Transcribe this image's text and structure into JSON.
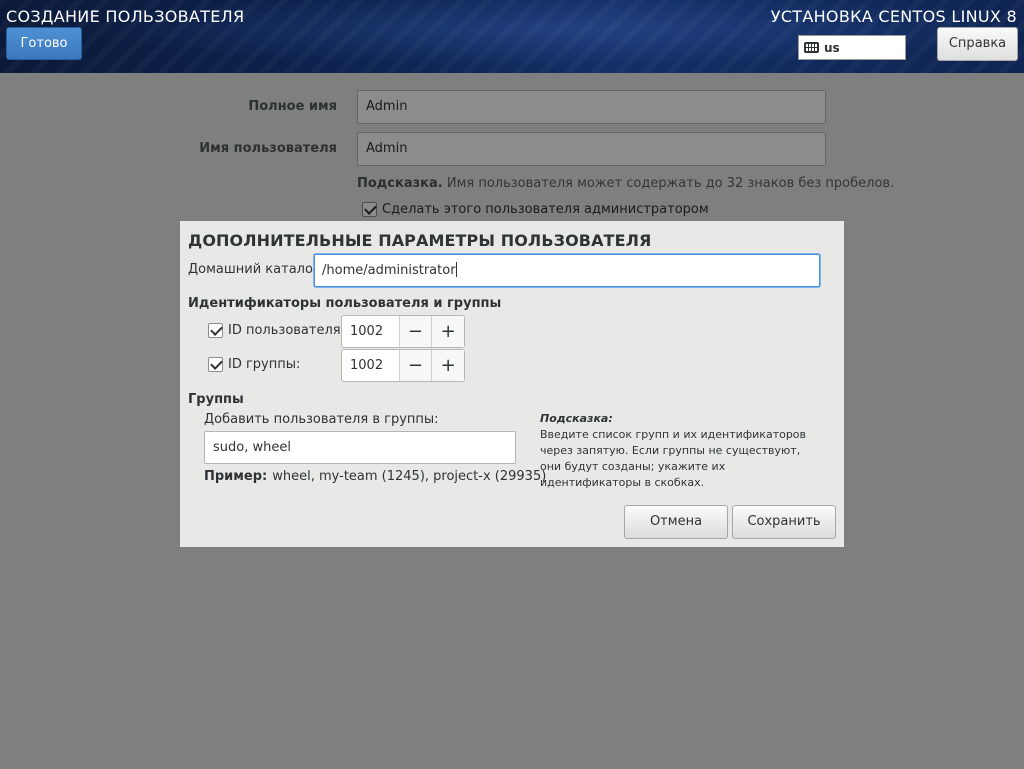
{
  "header": {
    "spoke_title": "СОЗДАНИЕ ПОЛЬЗОВАТЕЛЯ",
    "done_label": "Готово",
    "product_title": "УСТАНОВКА CENTOS LINUX 8",
    "keyboard_layout": "us",
    "help_label": "Справка"
  },
  "spoke": {
    "fullname_label": "Полное имя",
    "fullname_value": "Admin",
    "username_label": "Имя пользователя",
    "username_value": "Admin",
    "hint_bold": "Подсказка.",
    "hint_text": "Имя пользователя может содержать до 32 знаков без пробелов.",
    "admin_checkbox_label": "Сделать этого пользователя администратором",
    "admin_checked": true
  },
  "dialog": {
    "title": "ДОПОЛНИТЕЛЬНЫЕ ПАРАМЕТРЫ ПОЛЬЗОВАТЕЛЯ",
    "home_label": "Домашний каталог:",
    "home_value": "/home/administrator",
    "ids_section": "Идентификаторы пользователя и группы",
    "uid_label": "ID пользователя:",
    "uid_value": "1002",
    "uid_checked": true,
    "gid_label": "ID группы:",
    "gid_value": "1002",
    "gid_checked": true,
    "minus": "−",
    "plus": "+",
    "groups_section": "Группы",
    "groups_sub": "Добавить пользователя в группы:",
    "groups_value": "sudo, wheel",
    "example_bold": "Пример:",
    "example_text": "wheel, my-team (1245), project-x (29935)",
    "hint_title": "Подсказка:",
    "hint_text": "Введите список групп и их идентификаторов через запятую. Если группы не существуют, они будут созданы; укажите их идентификаторы в скобках.",
    "cancel_label": "Отмена",
    "save_label": "Сохранить"
  },
  "colors": {
    "header_bg": "#0d2350",
    "done_button": "#3a78be",
    "focus_ring": "#4a90d9",
    "dialog_bg": "#e8e8e7"
  },
  "icons": {
    "keyboard": "keyboard-icon",
    "check": "checkmark-icon"
  }
}
